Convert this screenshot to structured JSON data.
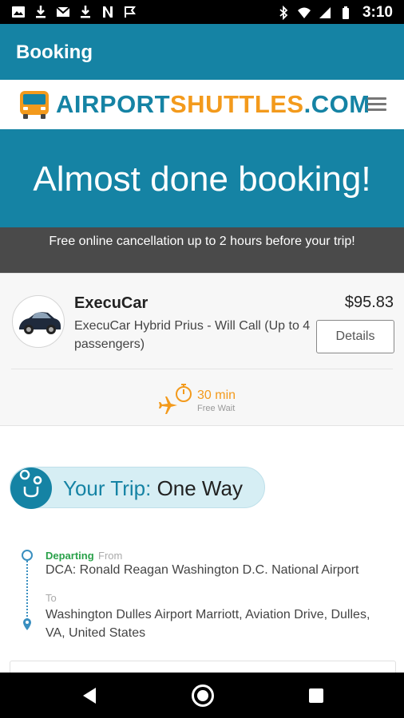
{
  "status_bar": {
    "time": "3:10"
  },
  "app_bar": {
    "title": "Booking"
  },
  "site_header": {
    "logo_part1": "AIRPORT",
    "logo_part2": "SHUTTLES",
    "logo_part3": ".COM"
  },
  "hero": {
    "title": "Almost done booking!",
    "notice": "Free online cancellation up to 2 hours before your trip!"
  },
  "vehicle": {
    "name": "ExecuCar",
    "description": "ExecuCar Hybrid Prius - Will Call (Up to 4 passengers)",
    "price": "$95.83",
    "details_label": "Details",
    "wait_time": "30 min",
    "wait_label": "Free Wait"
  },
  "trip": {
    "label": "Your Trip:",
    "type": "One Way",
    "departing_label": "Departing",
    "from_label": "From",
    "from_value": "DCA: Ronald Reagan Washington D.C. National Airport",
    "to_label": "To",
    "to_value": "Washington Dulles Airport Marriott, Aviation Drive, Dulles, VA, United States"
  },
  "colors": {
    "brand_teal": "#1583a4",
    "brand_orange": "#f39a1c",
    "departing_green": "#2aa14a"
  }
}
